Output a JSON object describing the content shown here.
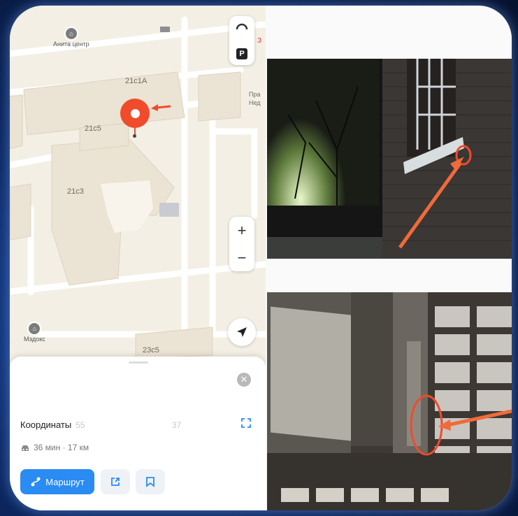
{
  "map": {
    "poi_top": {
      "label": "Анита центр",
      "icon": "building-icon"
    },
    "poi_bottom": {
      "label": "Мэдокс",
      "icon": "building-icon"
    },
    "building_labels": [
      "21с1А",
      "21с5",
      "21с3",
      "23с5"
    ],
    "edge_text": {
      "top_right": "З",
      "mid_right_1": "Пра",
      "mid_right_2": "Нед"
    },
    "parking_label": "P",
    "zoom_in": "+",
    "zoom_out": "−",
    "pin_color": "#f04b2b"
  },
  "sheet": {
    "coordinates_label": "Координаты",
    "coordinates_value": "55",
    "coordinates_tail": "37",
    "route_time": "36 мин · 17 км",
    "route_button": "Маршрут",
    "accent": "#2a8bf2"
  }
}
